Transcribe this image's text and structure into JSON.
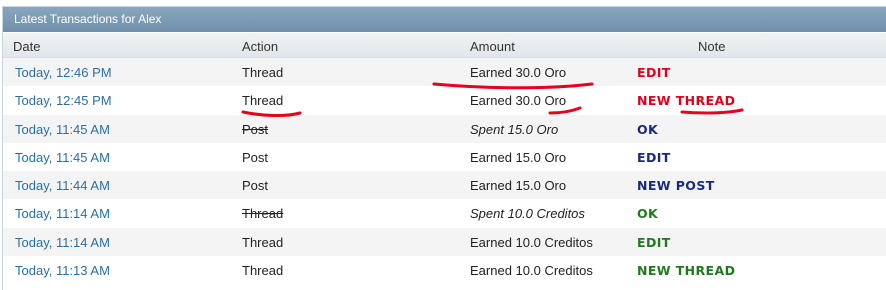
{
  "panel": {
    "title": "Latest Transactions for Alex"
  },
  "columns": {
    "date": "Date",
    "action": "Action",
    "amount": "Amount",
    "note": "Note"
  },
  "rows": [
    {
      "date": "Today, 12:46 PM",
      "action": "Thread",
      "amount": "Earned 30.0 Oro",
      "note": "EDIT",
      "note_color": "#e0001b",
      "amount_style": "normal",
      "action_struck": false
    },
    {
      "date": "Today, 12:45 PM",
      "action": "Thread",
      "amount": "Earned 30.0 Oro",
      "note": "NEW THREAD",
      "note_color": "#e0001b",
      "amount_style": "normal",
      "action_struck": false
    },
    {
      "date": "Today, 11:45 AM",
      "action": "Post",
      "amount": "Spent 15.0 Oro",
      "note": "OK",
      "note_color": "#1a2a7a",
      "amount_style": "italic",
      "action_struck": true
    },
    {
      "date": "Today, 11:45 AM",
      "action": "Post",
      "amount": "Earned 15.0 Oro",
      "note": "EDIT",
      "note_color": "#1a2a7a",
      "amount_style": "normal",
      "action_struck": false
    },
    {
      "date": "Today, 11:44 AM",
      "action": "Post",
      "amount": "Earned 15.0 Oro",
      "note": "NEW POST",
      "note_color": "#1a2a7a",
      "amount_style": "normal",
      "action_struck": false
    },
    {
      "date": "Today, 11:14 AM",
      "action": "Thread",
      "amount": "Spent 10.0 Creditos",
      "note": "OK",
      "note_color": "#1f7a1f",
      "amount_style": "italic",
      "action_struck": true
    },
    {
      "date": "Today, 11:14 AM",
      "action": "Thread",
      "amount": "Earned 10.0 Creditos",
      "note": "EDIT",
      "note_color": "#1f7a1f",
      "amount_style": "normal",
      "action_struck": false
    },
    {
      "date": "Today, 11:13 AM",
      "action": "Thread",
      "amount": "Earned 10.0 Creditos",
      "note": "NEW THREAD",
      "note_color": "#1f7a1f",
      "amount_style": "normal",
      "action_struck": false
    }
  ]
}
